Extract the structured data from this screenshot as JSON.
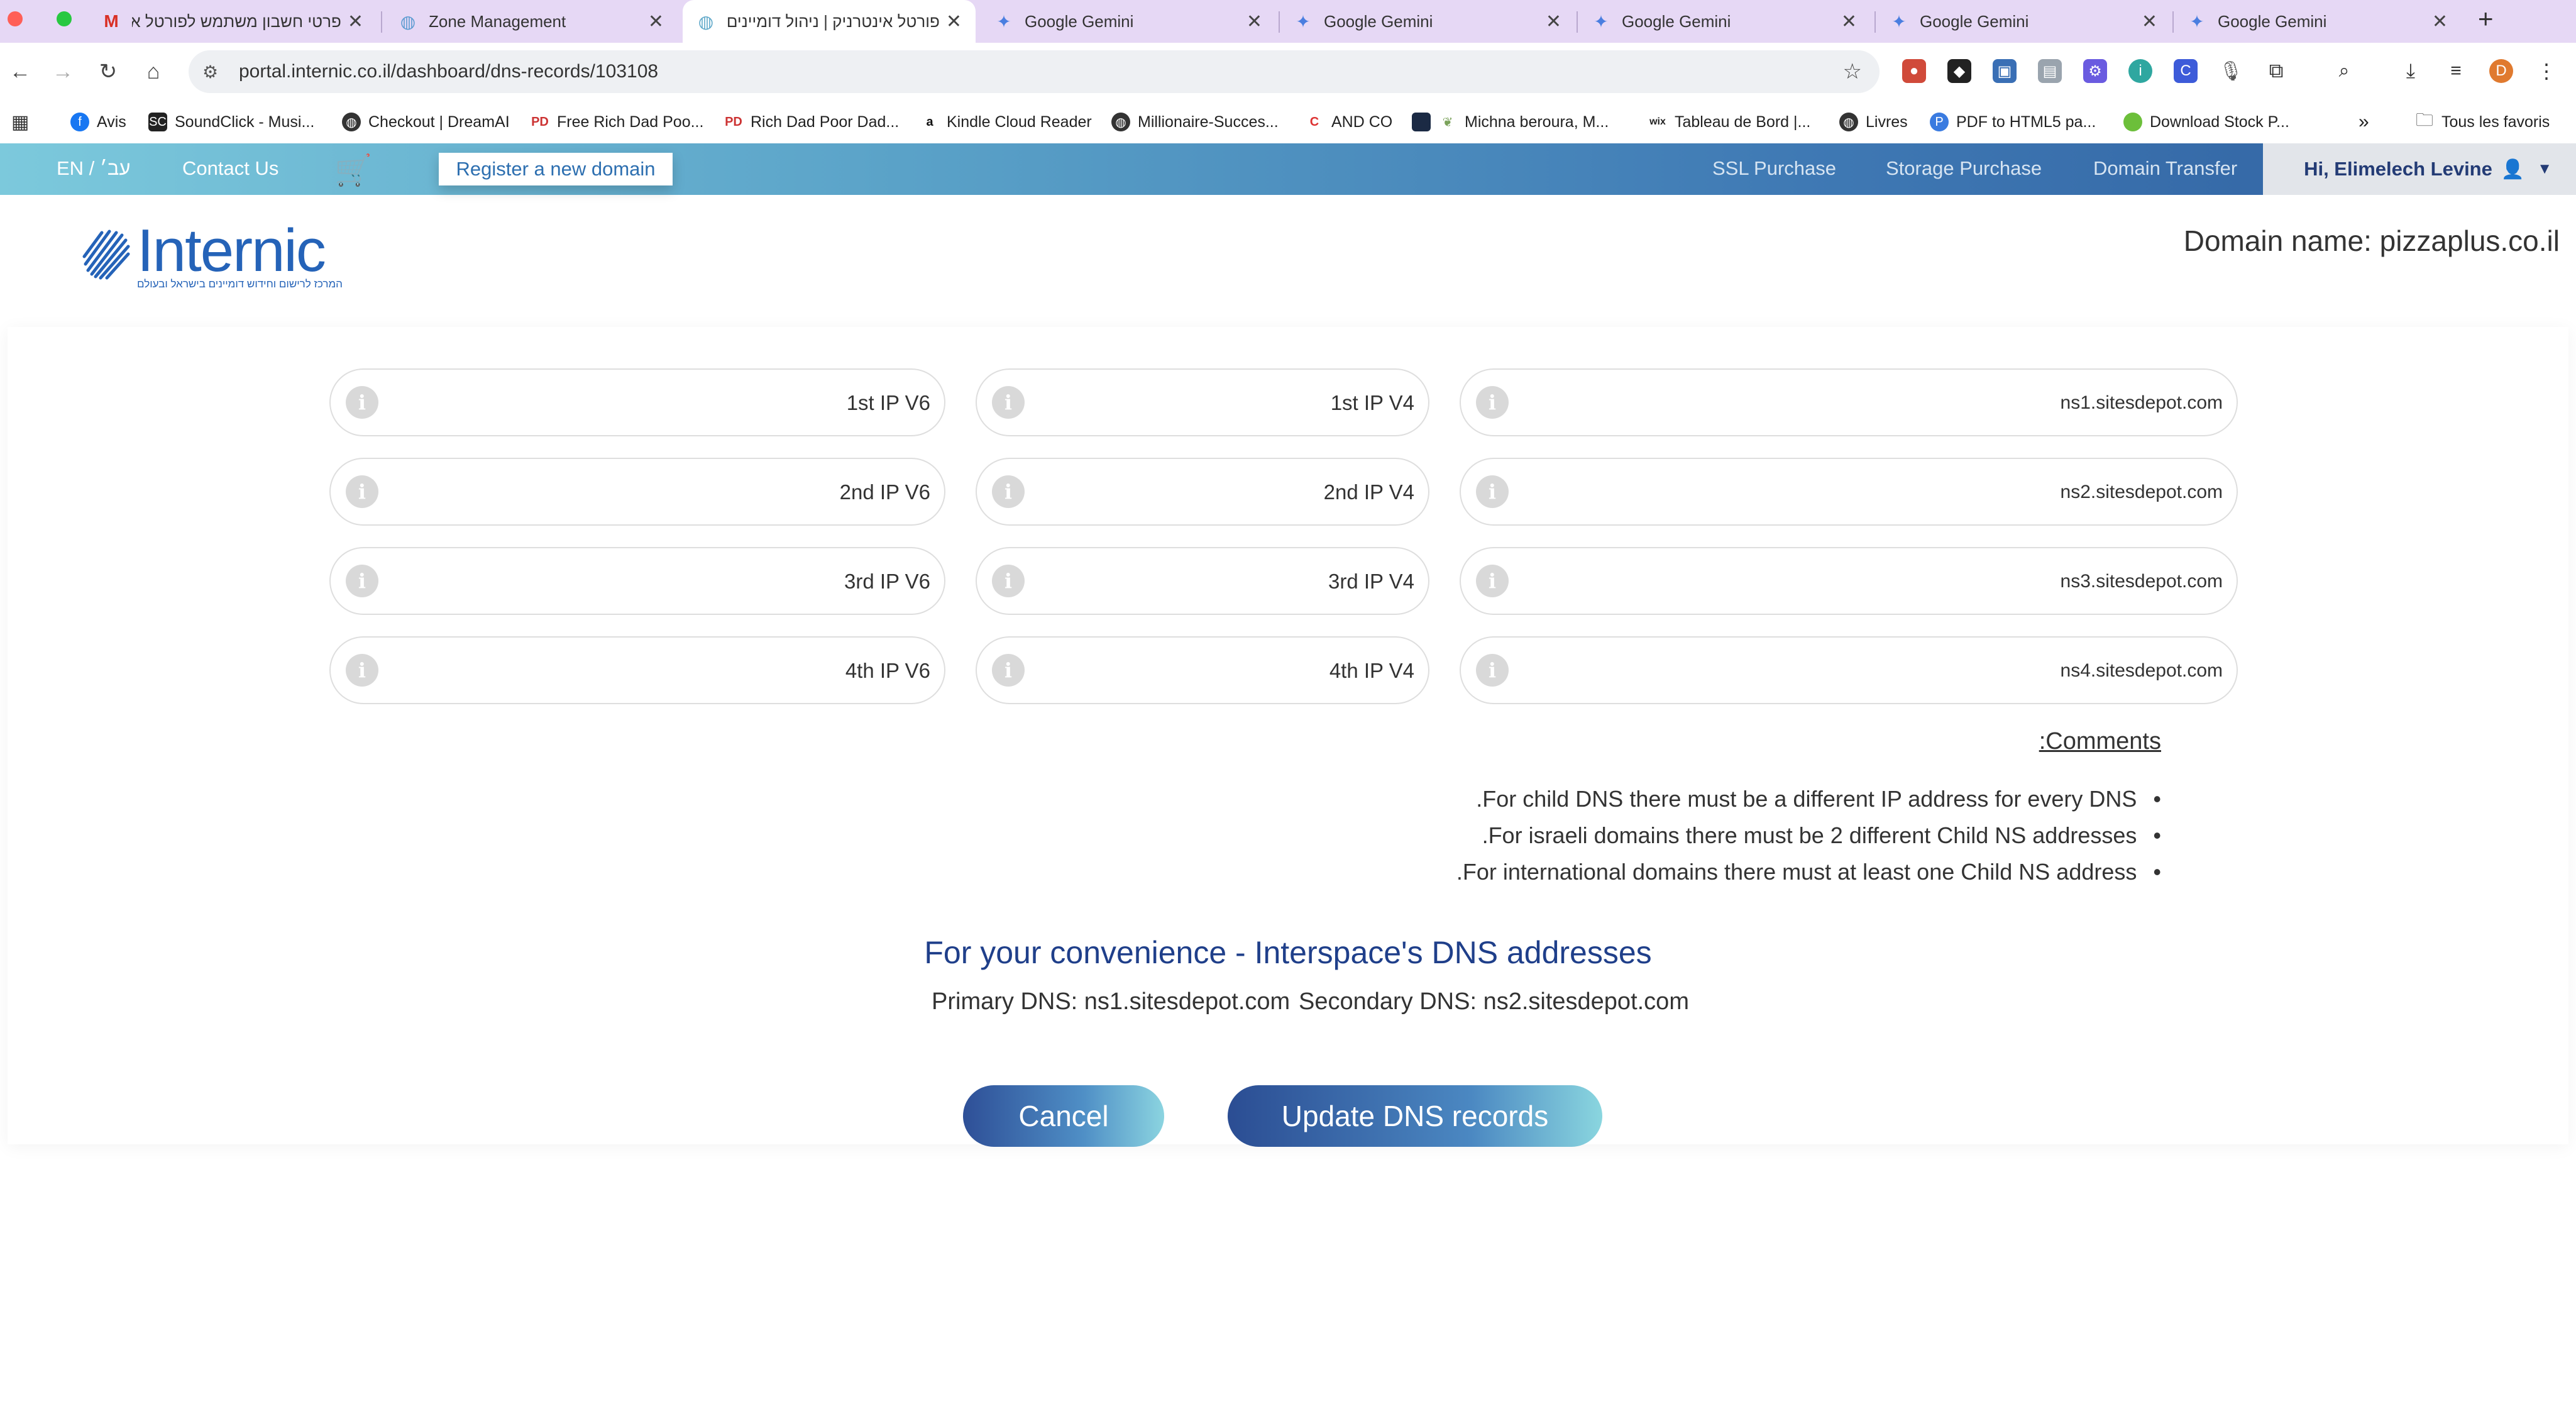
{
  "browser": {
    "tabs": [
      {
        "title": "פרטי חשבון משתמש לפורטל אי",
        "icon": "gmail-icon",
        "active": false
      },
      {
        "title": "Zone Management",
        "icon": "globe-icon",
        "active": false
      },
      {
        "title": "פורטל אינטרניק | ניהול דומיינים",
        "icon": "internic-icon",
        "active": true
      },
      {
        "title": "Google Gemini",
        "icon": "gemini-icon",
        "active": false
      },
      {
        "title": "Google Gemini",
        "icon": "gemini-icon",
        "active": false
      },
      {
        "title": "Google Gemini",
        "icon": "gemini-icon",
        "active": false
      },
      {
        "title": "Google Gemini",
        "icon": "gemini-icon",
        "active": false
      },
      {
        "title": "Google Gemini",
        "icon": "gemini-icon",
        "active": false
      }
    ],
    "new_tab": "+",
    "url": "portal.internic.co.il/dashboard/dns-records/103108",
    "profile_initial": "D",
    "bookmarks": [
      {
        "label": "Avis"
      },
      {
        "label": "SoundClick - Musi..."
      },
      {
        "label": "Checkout | DreamAI"
      },
      {
        "label": "Free Rich Dad Poo..."
      },
      {
        "label": "Rich Dad Poor Dad..."
      },
      {
        "label": "Kindle Cloud Reader"
      },
      {
        "label": "Millionaire-Succes..."
      },
      {
        "label": "AND CO"
      },
      {
        "label": "Michna beroura, M..."
      },
      {
        "label": "Tableau de Bord |..."
      },
      {
        "label": "Livres"
      },
      {
        "label": "PDF to HTML5 pa..."
      },
      {
        "label": "Download Stock P..."
      }
    ],
    "bookmarks_more": "»",
    "all_bookmarks": "Tous les favoris"
  },
  "header": {
    "lang": "EN / עב׳",
    "contact": "Contact Us",
    "register": "Register a new domain",
    "ssl": "SSL Purchase",
    "storage": "Storage Purchase",
    "transfer": "Domain Transfer",
    "user": "Hi, Elimelech Levine"
  },
  "logo": {
    "name": "Internic",
    "tagline": "המרכז לרישום וחידוש דומיינים בישראל ובעולם"
  },
  "domain_label": "Domain name: pizzaplus.co.il",
  "dns_fields": {
    "row1": {
      "ipv6": "1st IP V6",
      "ipv4": "1st IP V4",
      "ns": "ns1.sitesdepot.com"
    },
    "row2": {
      "ipv6": "2nd IP V6",
      "ipv4": "2nd IP V4",
      "ns": "ns2.sitesdepot.com"
    },
    "row3": {
      "ipv6": "3rd IP V6",
      "ipv4": "3rd IP V4",
      "ns": "ns3.sitesdepot.com"
    },
    "row4": {
      "ipv6": "4th IP V6",
      "ipv4": "4th IP V4",
      "ns": "ns4.sitesdepot.com"
    }
  },
  "comments": {
    "title": ":Comments",
    "items": [
      ".For child DNS there must be a different IP address for every DNS",
      ".For israeli domains there must be 2 different Child NS addresses",
      ".For international domains there must at least one Child NS address"
    ]
  },
  "convenience": {
    "title": "For your convenience - Interspace's DNS addresses",
    "primary": "Primary DNS: ns1.sitesdepot.com",
    "secondary": "Secondary DNS: ns2.sitesdepot.com"
  },
  "actions": {
    "cancel": "Cancel",
    "update": "Update DNS records"
  }
}
